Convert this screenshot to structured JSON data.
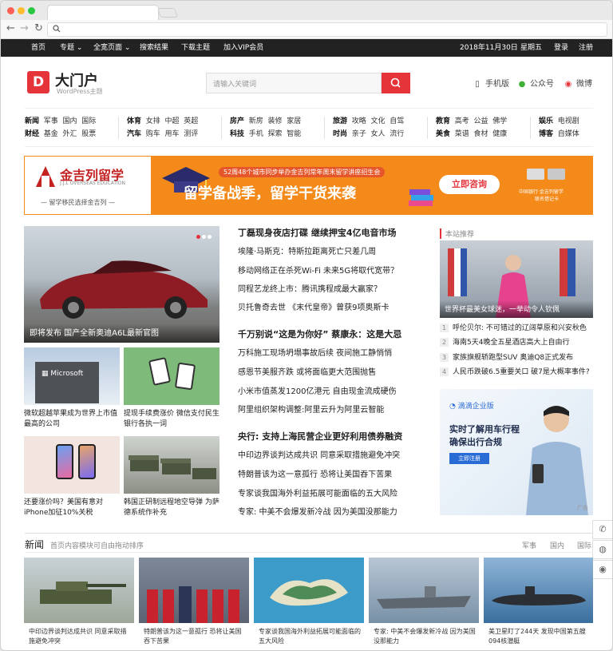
{
  "browser": {
    "url": "",
    "nav_icons": {
      "back": "back-arrow-icon",
      "forward": "forward-arrow-icon",
      "reload": "reload-icon",
      "search": "search-icon"
    }
  },
  "topbar": {
    "left": [
      "首页",
      "专题",
      "全宽页面",
      "搜索结果",
      "下载主题",
      "加入VIP会员"
    ],
    "date": "2018年11月30日",
    "weekday": "星期五",
    "login": "登录",
    "register": "注册"
  },
  "header": {
    "logo_letter": "D",
    "logo_title": "大门户",
    "logo_sub": "WordPress主题",
    "search_placeholder": "请输入关键词",
    "mobile": "手机版",
    "wechat": "公众号",
    "weibo": "微博"
  },
  "categories": [
    {
      "row1": [
        "新闻",
        "军事",
        "国内",
        "国际"
      ],
      "row2": [
        "财经",
        "基金",
        "外汇",
        "股票"
      ]
    },
    {
      "row1": [
        "体育",
        "女排",
        "中超",
        "英超"
      ],
      "row2": [
        "汽车",
        "购车",
        "用车",
        "测评"
      ]
    },
    {
      "row1": [
        "房产",
        "新房",
        "装修",
        "家居"
      ],
      "row2": [
        "科技",
        "手机",
        "探索",
        "智能"
      ]
    },
    {
      "row1": [
        "旅游",
        "攻略",
        "文化",
        "自驾"
      ],
      "row2": [
        "时尚",
        "亲子",
        "女人",
        "流行"
      ]
    },
    {
      "row1": [
        "教育",
        "高考",
        "公益",
        "佛学"
      ],
      "row2": [
        "美食",
        "菜谱",
        "食材",
        "健康"
      ]
    },
    {
      "row1": [
        "娱乐",
        "电视剧"
      ],
      "row2": [
        "博客",
        "自媒体"
      ]
    }
  ],
  "banner": {
    "brand": "金吉列留学",
    "brand_sub": "J.J.L OVERSEAS EDUCATION",
    "tagline": "— 留学移民选择金吉列 —",
    "headline_small": "52周48个城市同步举办金吉列常年周末留学讲座招生会",
    "headline": "留学备战季，留学干货来袭",
    "cta": "立即咨询",
    "bank_1": "中国银行·金吉列留学",
    "bank_2": "联名借记卡"
  },
  "slider": {
    "caption": "即将发布 国产全新奥迪A6L最新官图",
    "dots": 3
  },
  "thumbs": [
    {
      "caption": "微软超越苹果成为世界上市值最高的公司",
      "image": "microsoft-building-photo"
    },
    {
      "caption": "提现手续费涨价 微信支付民生银行各执一词",
      "image": "wechat-pay-qr-photo"
    },
    {
      "caption": "还要涨价吗？美国有意对iPhone加征10%关税",
      "image": "iphone-photo"
    },
    {
      "caption": "韩国正研制远程地空导弹 为萨德系统作补充",
      "image": "missile-trucks-photo"
    }
  ],
  "news": {
    "h1": "丁磊现身夜店打碟 继续押宝4亿电音市场",
    "g1": [
      "埃隆·马斯克：特斯拉距离死亡只差几周",
      "移动网络正在杀死Wi-Fi 未来5G将取代宽带？",
      "同程艺龙终上市：腾讯携程成最大赢家？",
      "贝托鲁奇去世 《末代皇帝》曾获9项奥斯卡"
    ],
    "h2": "千万别说“这是为你好” 蔡康永：这是大忌",
    "g2": [
      "万科施工现场坍塌事故后续 夜间施工静悄悄",
      "感恩节美服齐跌 或将面临更大范围抛售",
      "小米市值蒸发1200亿港元 自由现金流成硬伤",
      "阿里组织架构调整:阿里云升为阿里云智能"
    ],
    "h3": "央行: 支持上海民营企业更好利用债券融资",
    "g3": [
      "中印边界谈判达成共识 同意采取措施避免冲突",
      "特朗普该为这一意孤行 恐将让美国吞下苦果",
      "专家谈我国海外利益拓展可能面临的五大风险",
      "专家: 中美不会爆发新冷战 因为美国没那能力"
    ]
  },
  "right": {
    "title": "本站推荐",
    "hero_caption": "世界杯最美女球迷，一举动令人钦佩",
    "list": [
      {
        "n": "1",
        "text": "呼伦贝尔: 不可错过的辽阔草原和兴安秋色"
      },
      {
        "n": "2",
        "text": "海南5天4晚全五星酒店高大上自由行"
      },
      {
        "n": "3",
        "text": "家族旗舰轿跑型SUV 奥迪Q8正式发布"
      },
      {
        "n": "4",
        "text": "人民币跌破6.5重要关口 破7是大概率事件?"
      }
    ],
    "ad_brand": "滴滴企业版",
    "ad_line1": "实时了解用车行程",
    "ad_line2": "确保出行合规",
    "ad_btn": "立即注册",
    "ad_tag": "广告"
  },
  "side_tools": [
    "phone-icon",
    "wechat-icon",
    "weibo-icon"
  ],
  "bottom": {
    "title": "新闻",
    "subtitle": "首页内容模块可自由拖动排序",
    "tabs": [
      "军事",
      "国内",
      "国际"
    ],
    "items": [
      "中印边界谈判达成共识 同意采取措施避免冲突",
      "特朗普该为这一意孤行 恐将让美国吞下苦果",
      "专家谈我国海外利益拓展可能面临的五大风险",
      "专家: 中美不会爆发新冷战 因为美国没那能力",
      "美卫星盯了244天 发现中国第五艘094核潜艇"
    ]
  }
}
